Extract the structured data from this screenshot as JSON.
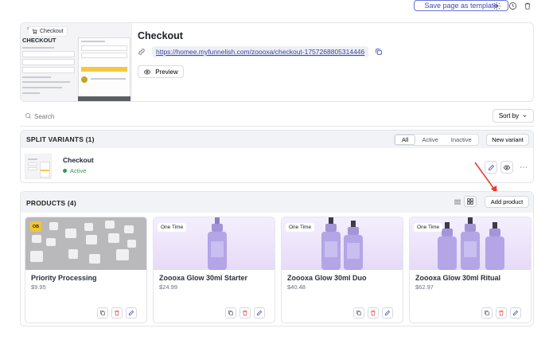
{
  "topbar": {
    "save_template_label": "Save page as template",
    "icons": [
      "gear-icon",
      "history-icon",
      "trash-icon"
    ]
  },
  "header": {
    "thumbnail_tag": "Checkout",
    "thumbnail_heading": "CHECKOUT",
    "thumbnail_brand": "zoooxa",
    "title": "Checkout",
    "url": "https://homee.myfunnelish.com/zoooxa/checkout-1757268805314446",
    "preview_label": "Preview"
  },
  "search": {
    "placeholder": "Search",
    "sort_label": "Sort by"
  },
  "split_variants": {
    "title": "SPLIT VARIANTS (1)",
    "filters": [
      "All",
      "Active",
      "Inactive"
    ],
    "active_filter": "All",
    "new_variant_label": "New variant",
    "variants": [
      {
        "name": "Checkout",
        "status": "Active"
      }
    ]
  },
  "products": {
    "title": "PRODUCTS (4)",
    "add_label": "Add product",
    "items": [
      {
        "name": "Priority Processing",
        "price": "$9.95",
        "badge": "",
        "image_badge": "OB"
      },
      {
        "name": "Zoooxa Glow 30ml Starter",
        "price": "$24.99",
        "badge": "One Time"
      },
      {
        "name": "Zoooxa Glow 30ml Duo",
        "price": "$40.48",
        "badge": "One Time"
      },
      {
        "name": "Zoooxa Glow 30ml Ritual",
        "price": "$62.97",
        "badge": "One Time"
      }
    ]
  },
  "colors": {
    "accent": "#3f48b8",
    "active_green": "#2e9d59",
    "danger": "#e04848",
    "product_purple": "#a793dd"
  }
}
